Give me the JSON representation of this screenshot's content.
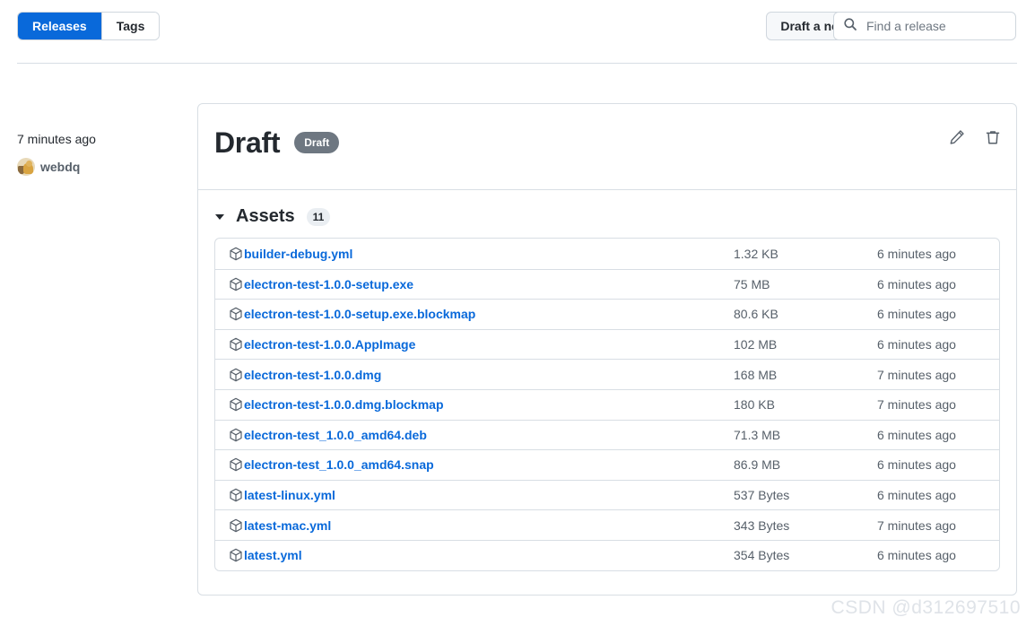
{
  "toolbar": {
    "tabs": [
      {
        "label": "Releases",
        "active": true
      },
      {
        "label": "Tags",
        "active": false
      }
    ],
    "draft_button": "Draft a new release",
    "search": {
      "placeholder": "Find a release",
      "value": "",
      "icon": "search-icon"
    }
  },
  "meta": {
    "time": "7 minutes ago",
    "author": "webdq",
    "avatar_icon": "avatar-cat-image"
  },
  "release": {
    "title": "Draft",
    "badge": "Draft",
    "edit_icon": "pencil-icon",
    "delete_icon": "trash-icon"
  },
  "assets": {
    "label": "Assets",
    "count": "11",
    "caret_icon": "caret-down-icon",
    "item_icon": "package-icon",
    "items": [
      {
        "name": "builder-debug.yml",
        "size": "1.32 KB",
        "time": "6 minutes ago"
      },
      {
        "name": "electron-test-1.0.0-setup.exe",
        "size": "75 MB",
        "time": "6 minutes ago"
      },
      {
        "name": "electron-test-1.0.0-setup.exe.blockmap",
        "size": "80.6 KB",
        "time": "6 minutes ago"
      },
      {
        "name": "electron-test-1.0.0.AppImage",
        "size": "102 MB",
        "time": "6 minutes ago"
      },
      {
        "name": "electron-test-1.0.0.dmg",
        "size": "168 MB",
        "time": "7 minutes ago"
      },
      {
        "name": "electron-test-1.0.0.dmg.blockmap",
        "size": "180 KB",
        "time": "7 minutes ago"
      },
      {
        "name": "electron-test_1.0.0_amd64.deb",
        "size": "71.3 MB",
        "time": "6 minutes ago"
      },
      {
        "name": "electron-test_1.0.0_amd64.snap",
        "size": "86.9 MB",
        "time": "6 minutes ago"
      },
      {
        "name": "latest-linux.yml",
        "size": "537 Bytes",
        "time": "6 minutes ago"
      },
      {
        "name": "latest-mac.yml",
        "size": "343 Bytes",
        "time": "7 minutes ago"
      },
      {
        "name": "latest.yml",
        "size": "354 Bytes",
        "time": "6 minutes ago"
      }
    ]
  },
  "watermark": "CSDN @d312697510",
  "colors": {
    "accent": "#0969da",
    "link": "#0969da",
    "badge_gray": "#6e7781",
    "border": "#d8dee4",
    "muted_text": "#57606a"
  }
}
